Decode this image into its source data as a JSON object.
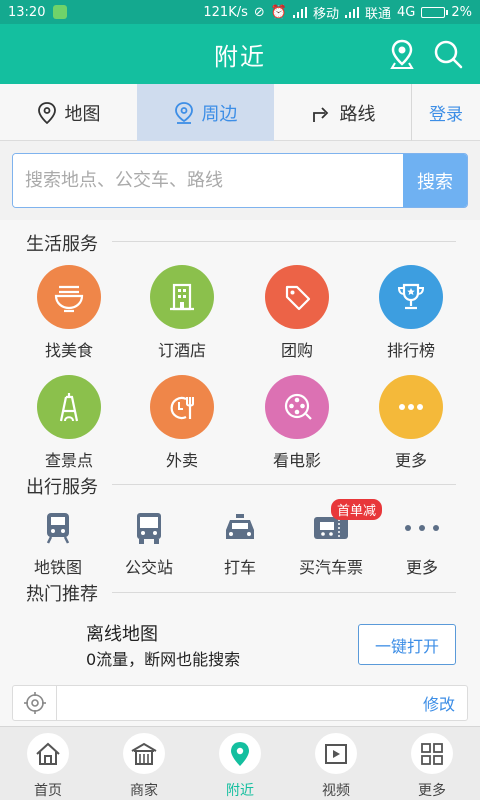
{
  "status": {
    "time": "13:20",
    "speed": "121K/s",
    "carrier1": "移动",
    "carrier2": "联通",
    "network": "4G",
    "battery": "2%"
  },
  "header": {
    "title": "附近"
  },
  "tabs": [
    {
      "label": "地图",
      "icon": "map-pin-icon"
    },
    {
      "label": "周边",
      "icon": "nearby-pin-icon"
    },
    {
      "label": "路线",
      "icon": "route-icon"
    }
  ],
  "login_label": "登录",
  "search": {
    "placeholder": "搜索地点、公交车、路线",
    "button": "搜索"
  },
  "life": {
    "title": "生活服务",
    "items": [
      {
        "label": "找美食",
        "color": "#ef8649",
        "icon": "noodle-bowl-icon"
      },
      {
        "label": "订酒店",
        "color": "#8bc04c",
        "icon": "hotel-icon"
      },
      {
        "label": "团购",
        "color": "#ec6347",
        "icon": "tag-icon"
      },
      {
        "label": "排行榜",
        "color": "#3d9ee0",
        "icon": "trophy-icon"
      },
      {
        "label": "查景点",
        "color": "#8bc04c",
        "icon": "tower-icon"
      },
      {
        "label": "外卖",
        "color": "#ef8649",
        "icon": "takeout-icon"
      },
      {
        "label": "看电影",
        "color": "#dc71b3",
        "icon": "film-reel-icon"
      },
      {
        "label": "更多",
        "color": "#f4b93a",
        "icon": "more-dots-icon"
      }
    ]
  },
  "travel": {
    "title": "出行服务",
    "items": [
      {
        "label": "地铁图",
        "icon": "subway-icon"
      },
      {
        "label": "公交站",
        "icon": "bus-icon"
      },
      {
        "label": "打车",
        "icon": "taxi-icon"
      },
      {
        "label": "买汽车票",
        "icon": "bus-ticket-icon",
        "badge": "首单减"
      },
      {
        "label": "更多",
        "icon": "more-dots-icon"
      }
    ]
  },
  "hot": {
    "title": "热门推荐",
    "promo_title": "离线地图",
    "promo_sub": "0流量，断网也能搜索",
    "promo_button": "一键打开"
  },
  "location_bar": {
    "edit": "修改"
  },
  "nav": [
    {
      "label": "首页",
      "icon": "home-icon"
    },
    {
      "label": "商家",
      "icon": "shop-icon"
    },
    {
      "label": "附近",
      "icon": "nearby-icon"
    },
    {
      "label": "视频",
      "icon": "video-icon"
    },
    {
      "label": "更多",
      "icon": "grid-icon"
    }
  ],
  "colors": {
    "header": "#14bf9f",
    "accent_blue": "#3d8ee6",
    "active_tab_bg": "#cfdcee",
    "search_button": "#6fb1f2",
    "badge": "#e8373a",
    "travel_icon": "#5d6f87"
  }
}
